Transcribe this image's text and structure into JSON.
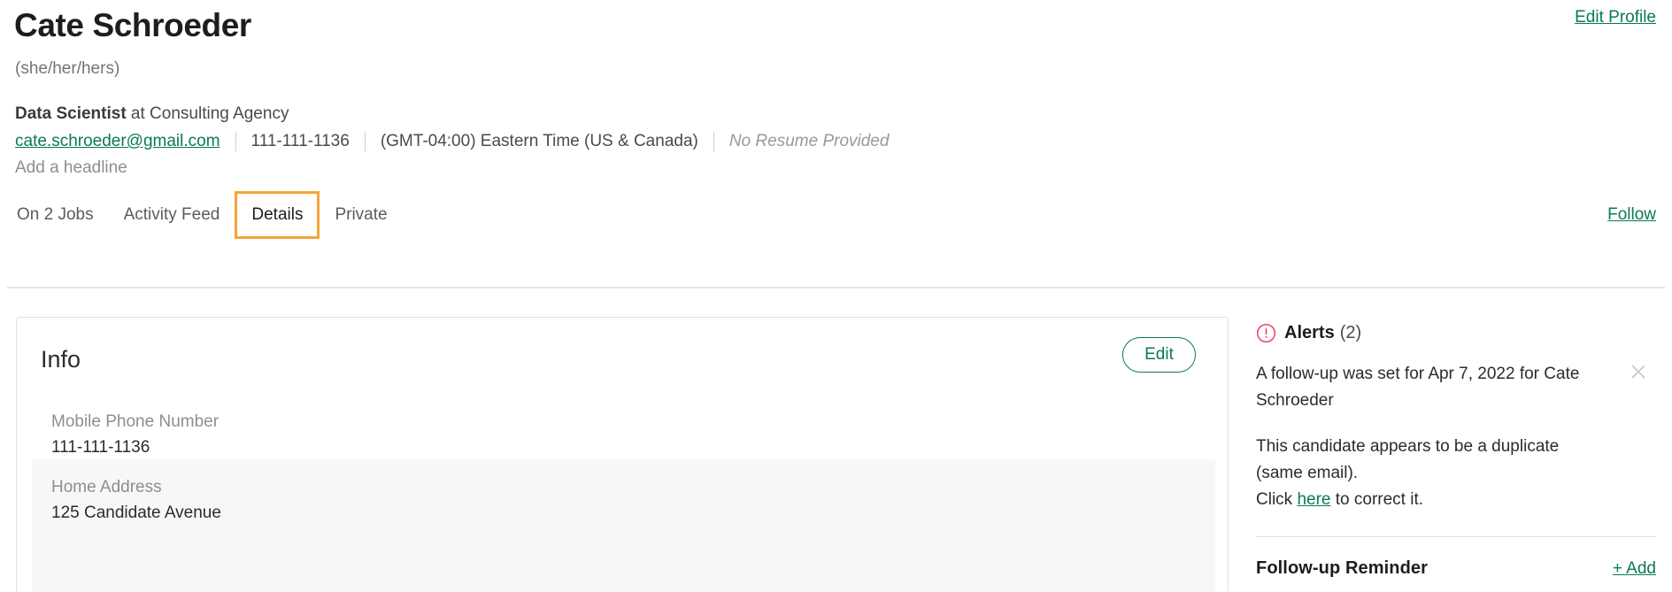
{
  "profile": {
    "name": "Cate Schroeder",
    "pronouns": "(she/her/hers)",
    "edit_profile_label": "Edit Profile",
    "job_title": "Data Scientist",
    "at_company": " at Consulting Agency",
    "email": "cate.schroeder@gmail.com",
    "phone": "111-111-1136",
    "timezone": "(GMT-04:00) Eastern Time (US & Canada)",
    "resume_status": "No Resume Provided",
    "add_headline": "Add a headline"
  },
  "tabs": {
    "items": [
      {
        "label": "On 2 Jobs",
        "selected": false
      },
      {
        "label": "Activity Feed",
        "selected": false
      },
      {
        "label": "Details",
        "selected": true
      },
      {
        "label": "Private",
        "selected": false
      }
    ],
    "follow_label": "Follow",
    "selected_outline_color": "#f5a43a"
  },
  "info_card": {
    "title": "Info",
    "edit_label": "Edit",
    "fields": [
      {
        "label": "Mobile Phone Number",
        "value": "111-111-1136"
      },
      {
        "label": "Home Address",
        "value": "125 Candidate Avenue"
      }
    ]
  },
  "alerts": {
    "icon": "alert-circle-icon",
    "title": "Alerts",
    "count": "(2)",
    "icon_color": "#e8456b",
    "items": [
      {
        "text": "A follow-up was set for Apr 7, 2022 for Cate Schroeder",
        "dismissable": true
      },
      {
        "line1": "This candidate appears to be a duplicate (same email).",
        "line2_before": "Click ",
        "link": "here",
        "line2_after": " to correct it.",
        "dismissable": false
      }
    ]
  },
  "followup": {
    "title": "Follow-up Reminder",
    "add_label": "+ Add"
  },
  "colors": {
    "accent_green": "#0a7a52",
    "tab_highlight": "#f5a43a",
    "alert_red": "#e8456b"
  }
}
